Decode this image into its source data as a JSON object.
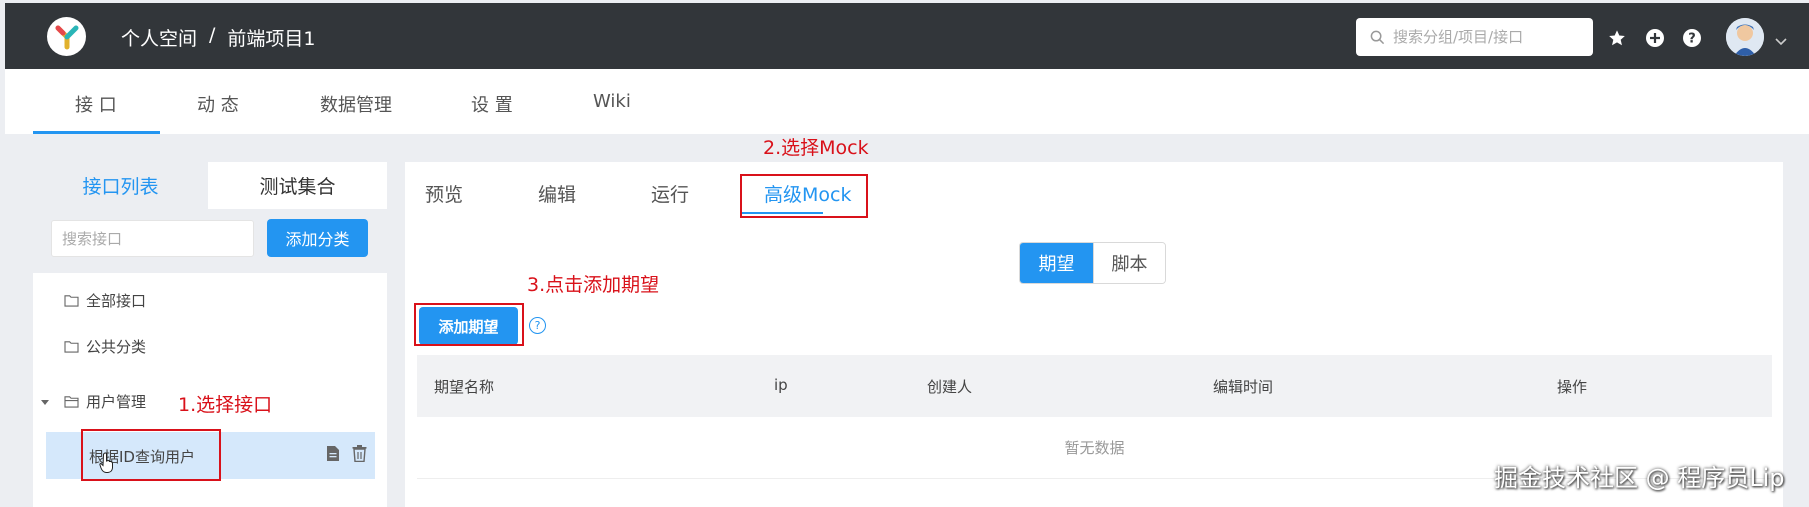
{
  "header": {
    "breadcrumb_space": "个人空间",
    "breadcrumb_sep": "/",
    "breadcrumb_project": "前端项目1",
    "search_placeholder": "搜索分组/项目/接口"
  },
  "project_tabs": [
    {
      "label": "接 口",
      "active": true
    },
    {
      "label": "动 态",
      "active": false
    },
    {
      "label": "数据管理",
      "active": false
    },
    {
      "label": "设 置",
      "active": false
    },
    {
      "label": "Wiki",
      "active": false
    }
  ],
  "sidebar": {
    "tab_list": "接口列表",
    "tab_collection": "测试集合",
    "search_placeholder": "搜索接口",
    "add_category": "添加分类",
    "tree": {
      "all": "全部接口",
      "public": "公共分类",
      "user_mgmt": "用户管理",
      "selected_interface": "根据ID查询用户"
    }
  },
  "main": {
    "tabs": [
      "预览",
      "编辑",
      "运行",
      "高级Mock"
    ],
    "active_tab": "高级Mock",
    "segment_expect": "期望",
    "segment_script": "脚本",
    "add_expectation": "添加期望",
    "help_glyph": "?",
    "table_headers": [
      "期望名称",
      "ip",
      "创建人",
      "编辑时间",
      "操作"
    ],
    "empty_text": "暂无数据"
  },
  "annotations": {
    "step1": "1.选择接口",
    "step2": "2.选择Mock",
    "step3": "3.点击添加期望"
  },
  "watermark": "掘金技术社区 @ 程序员Lip",
  "colors": {
    "header_bg": "#32363a",
    "accent": "#2395f1",
    "annotation_red": "#d9111a",
    "selected_row": "#d5e8fb"
  }
}
